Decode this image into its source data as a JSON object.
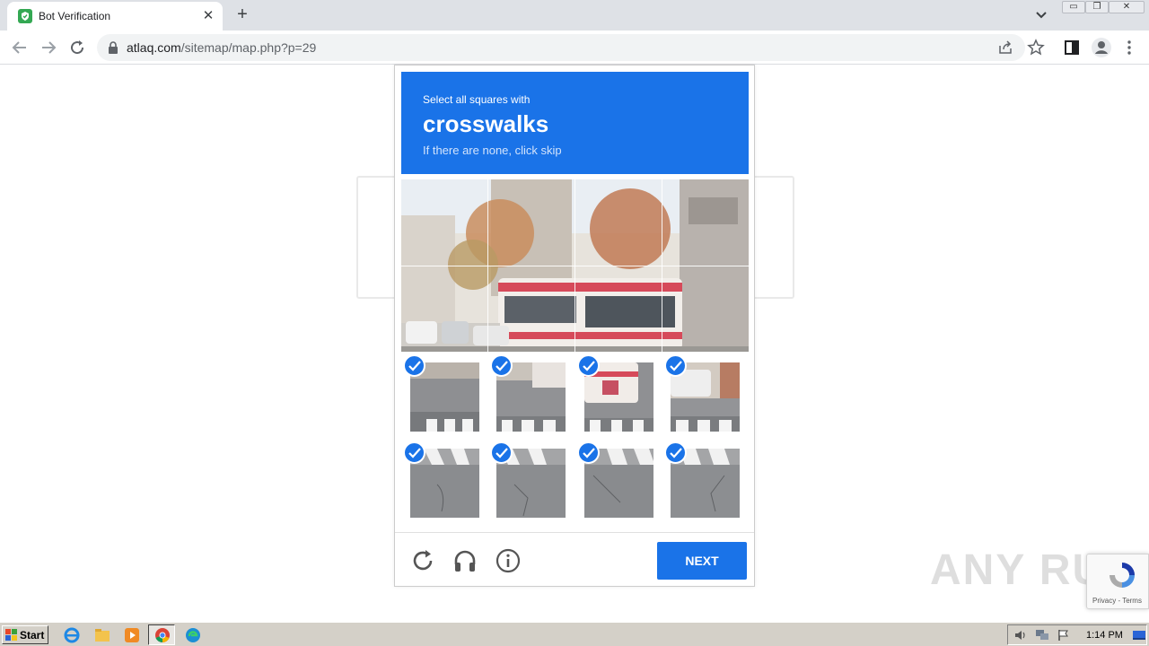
{
  "browser": {
    "tab_title": "Bot Verification",
    "tab_close": "✕",
    "new_tab": "+",
    "url_host": "atlaq.com",
    "url_path": "/sitemap/map.php?p=29",
    "window_min": "▭",
    "window_restore": "❐",
    "window_close": "✕"
  },
  "captcha": {
    "prompt": "Select all squares with",
    "keyword": "crosswalks",
    "hint": "If there are none, click skip",
    "next_label": "NEXT",
    "selected_tiles": 8
  },
  "watermark": "ANY RUN",
  "recaptcha_terms": "Privacy - Terms",
  "taskbar": {
    "start_label": "Start",
    "clock": "1:14 PM"
  },
  "colors": {
    "accent": "#1a73e8"
  }
}
